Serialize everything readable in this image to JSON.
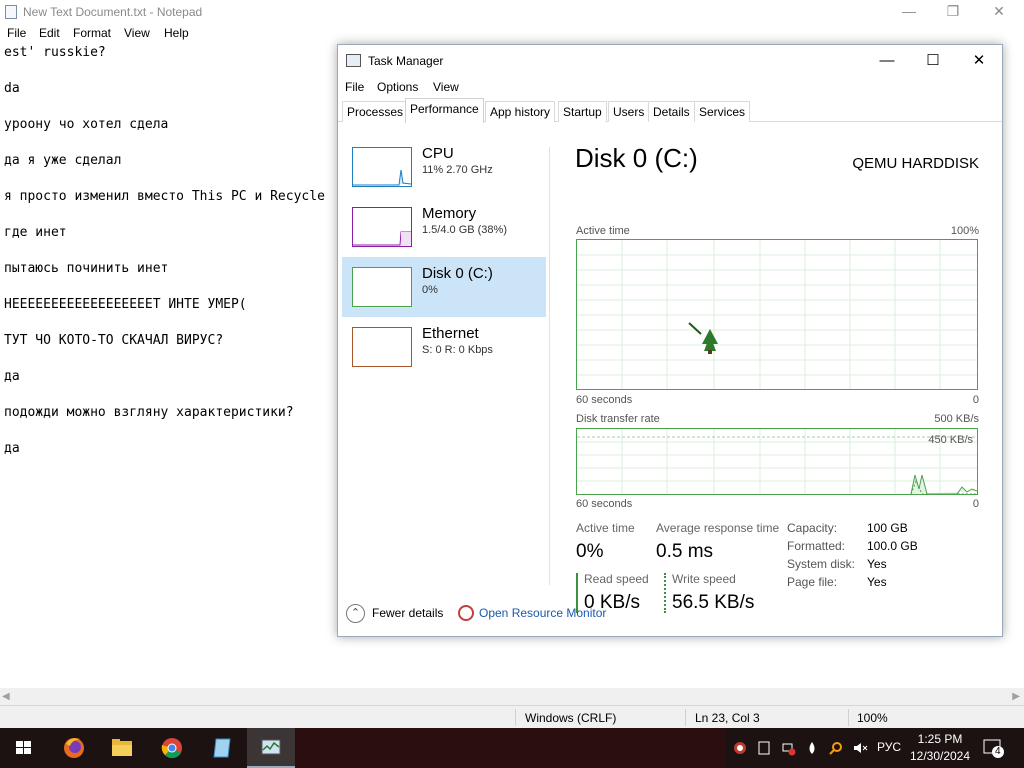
{
  "notepad": {
    "title": "New Text Document.txt - Notepad",
    "menu": [
      "File",
      "Edit",
      "Format",
      "View",
      "Help"
    ],
    "lines": [
      "est' russkie?",
      "da",
      "уроону чо хотел сдела",
      "да я уже сделал",
      "я просто изменил вместо This PC и Recycle",
      "где инет",
      "пытаюсь починить инет",
      "НЕЕЕЕЕЕЕЕЕЕЕЕЕЕЕЕЕЕТ ИНТЕ УМЕР(",
      "ТУТ ЧО КОТО-ТО СКАЧАЛ ВИРУС?",
      "да",
      "подожди можно взгляну характеристики?",
      "да"
    ],
    "status": {
      "line_ending": "Windows (CRLF)",
      "position": "Ln 23, Col 3",
      "zoom": "100%"
    }
  },
  "taskmanager": {
    "title": "Task Manager",
    "menu": [
      "File",
      "Options",
      "View"
    ],
    "tabs": [
      "Processes",
      "Performance",
      "App history",
      "Startup",
      "Users",
      "Details",
      "Services"
    ],
    "active_tab": "Performance",
    "sidebar": [
      {
        "name": "CPU",
        "sub": "11%  2.70 GHz",
        "color": "#1e7fc0"
      },
      {
        "name": "Memory",
        "sub": "1.5/4.0 GB (38%)",
        "color": "#8b1fa8"
      },
      {
        "name": "Disk 0 (C:)",
        "sub": "0%",
        "color": "#4aa34a"
      },
      {
        "name": "Ethernet",
        "sub": "S: 0  R: 0 Kbps",
        "color": "#a7552a"
      }
    ],
    "disk": {
      "title": "Disk 0 (C:)",
      "model": "QEMU HARDDISK",
      "active_time_label": "Active time",
      "active_time_max": "100%",
      "axis_seconds": "60 seconds",
      "axis_zero": "0",
      "transfer_label": "Disk transfer rate",
      "transfer_max": "500 KB/s",
      "transfer_mid": "450 KB/s",
      "stats": {
        "active_time_label": "Active time",
        "active_time": "0%",
        "avg_resp_label": "Average response time",
        "avg_resp": "0.5 ms",
        "read_label": "Read speed",
        "read": "0 KB/s",
        "write_label": "Write speed",
        "write": "56.5 KB/s"
      },
      "properties": [
        {
          "k": "Capacity:",
          "v": "100 GB"
        },
        {
          "k": "Formatted:",
          "v": "100.0 GB"
        },
        {
          "k": "System disk:",
          "v": "Yes"
        },
        {
          "k": "Page file:",
          "v": "Yes"
        }
      ]
    },
    "footer": {
      "fewer": "Fewer details",
      "resource_monitor": "Open Resource Monitor"
    }
  },
  "taskbar": {
    "time": "1:25 PM",
    "date": "12/30/2024",
    "language": "РУС",
    "notifications": "4"
  }
}
